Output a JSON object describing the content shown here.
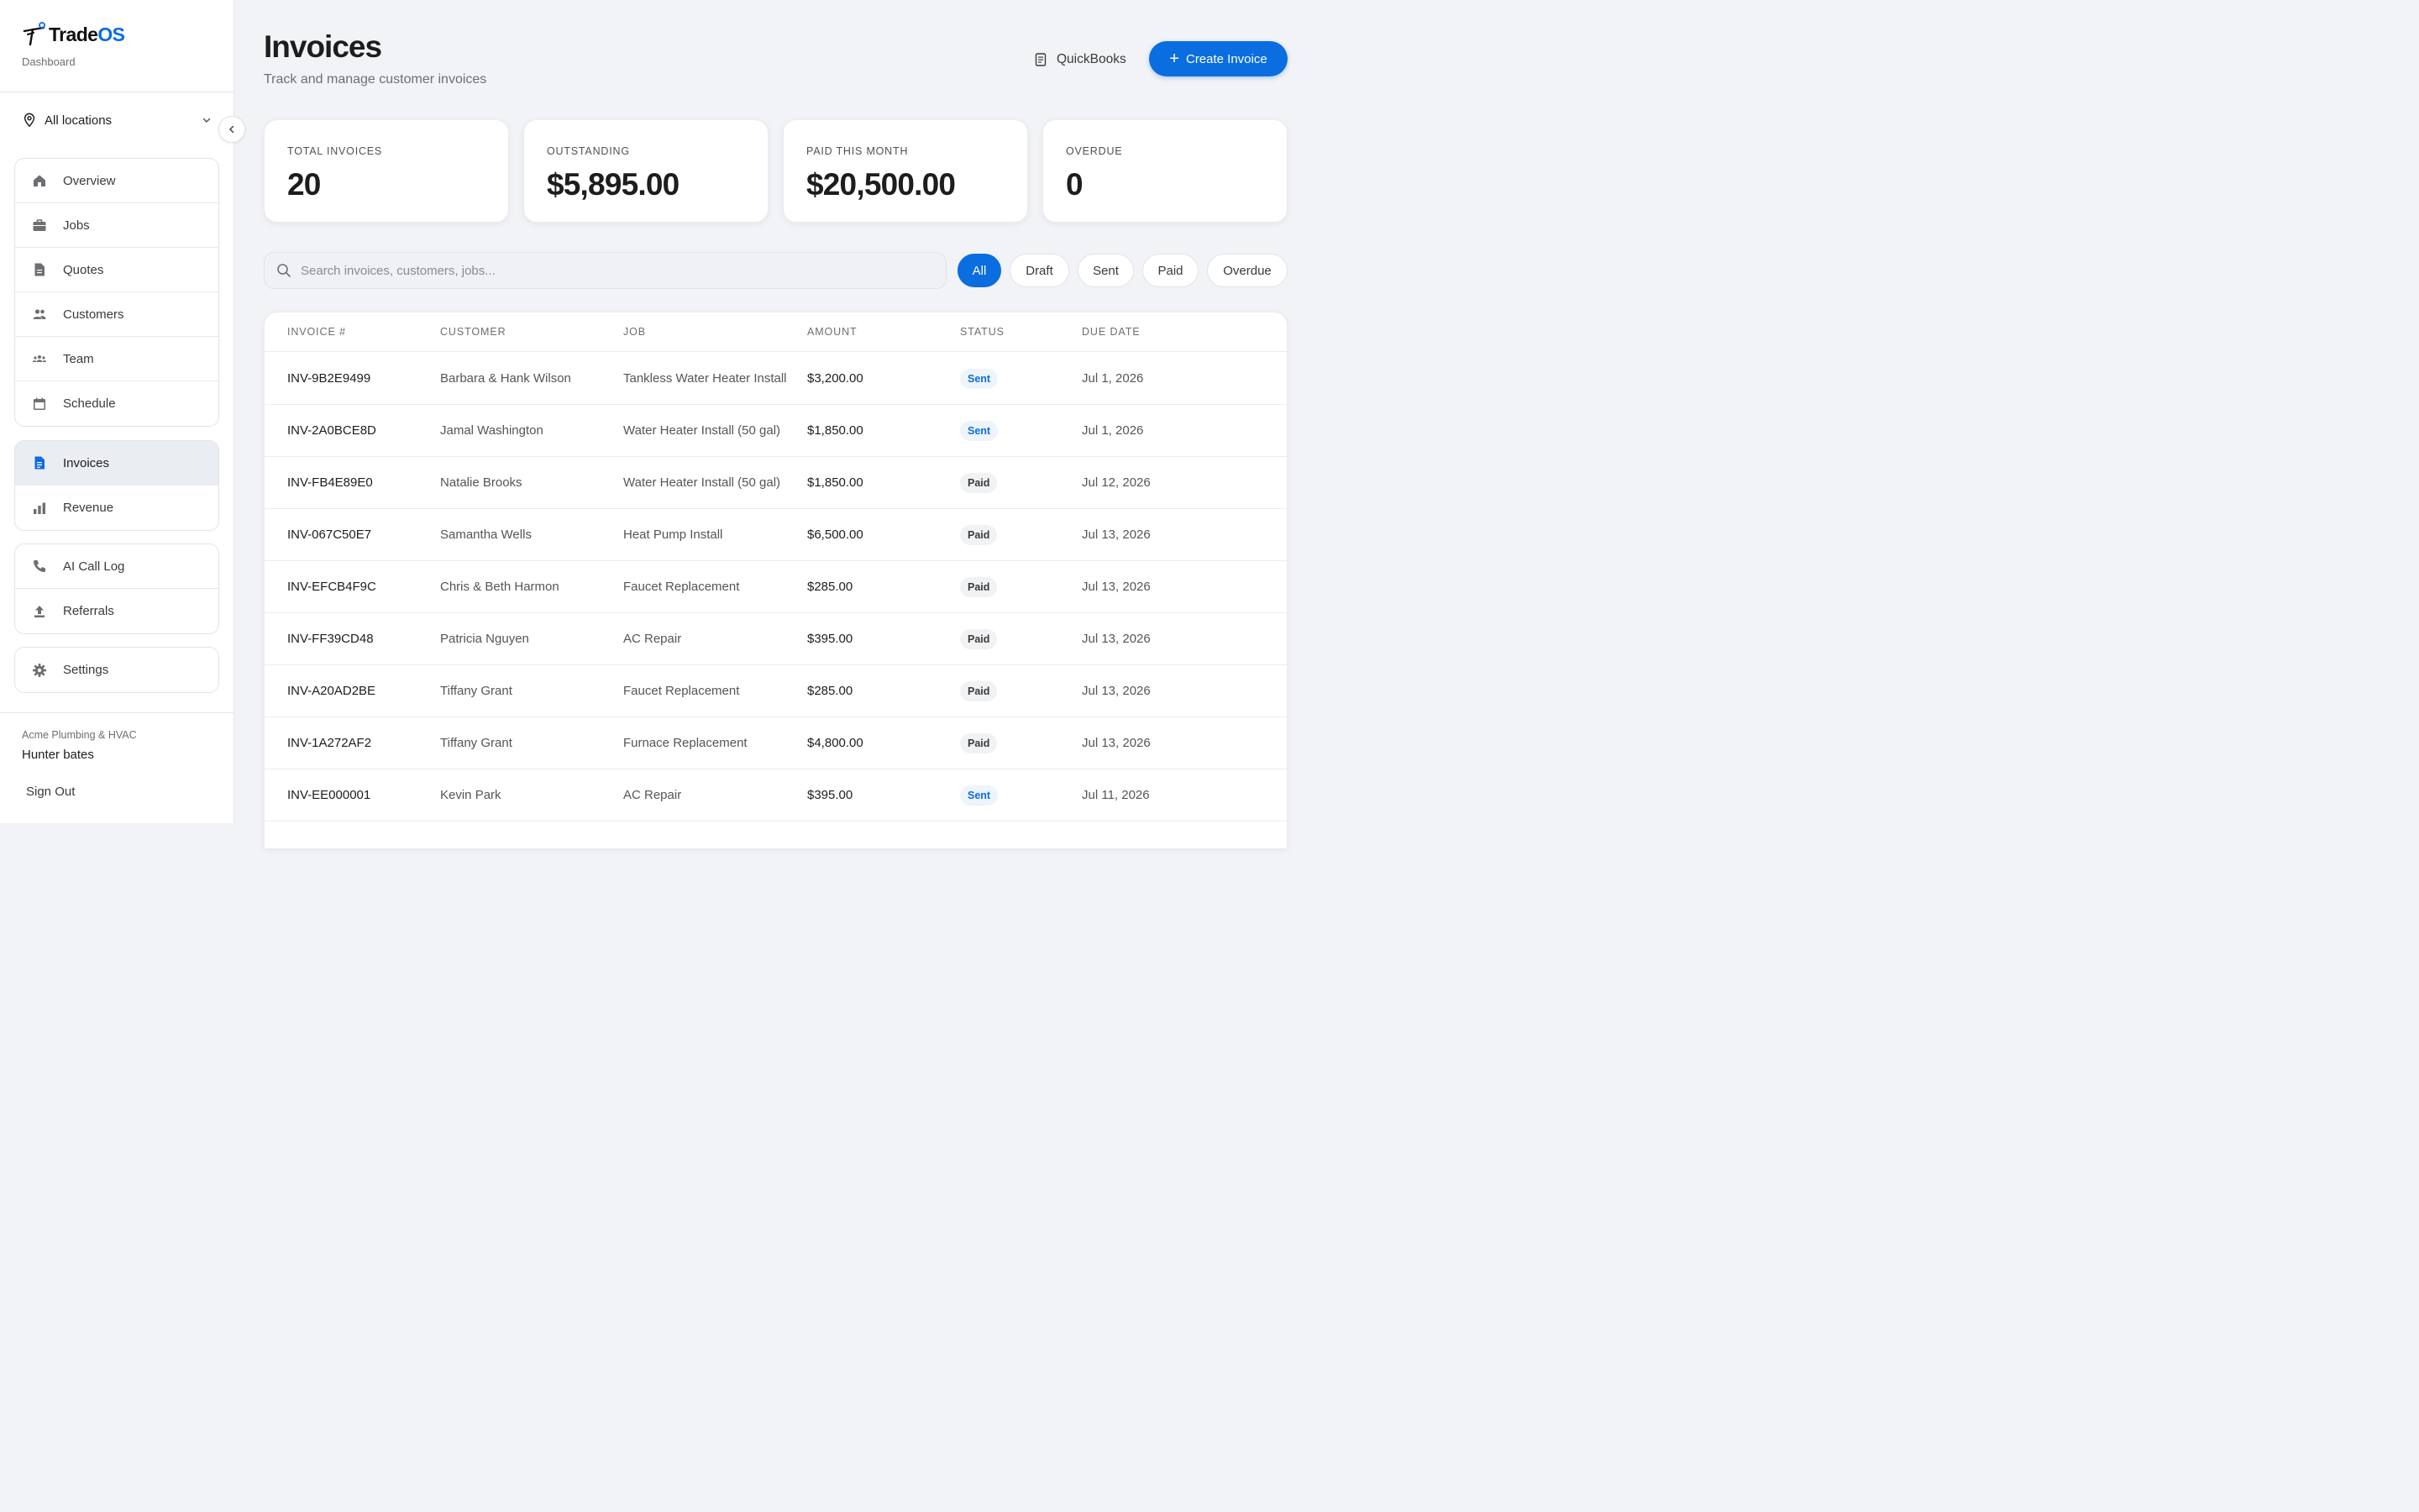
{
  "brand": {
    "name_main": "Trade",
    "name_accent": "OS",
    "subtitle": "Dashboard",
    "accent_color": "#0a6de0"
  },
  "location": {
    "label": "All locations"
  },
  "nav": {
    "main": [
      {
        "id": "overview",
        "label": "Overview",
        "icon": "home-icon"
      },
      {
        "id": "jobs",
        "label": "Jobs",
        "icon": "briefcase-icon"
      },
      {
        "id": "quotes",
        "label": "Quotes",
        "icon": "document-icon"
      },
      {
        "id": "customers",
        "label": "Customers",
        "icon": "people-icon"
      },
      {
        "id": "team",
        "label": "Team",
        "icon": "team-icon"
      },
      {
        "id": "schedule",
        "label": "Schedule",
        "icon": "calendar-icon"
      }
    ],
    "finance": [
      {
        "id": "invoices",
        "label": "Invoices",
        "icon": "invoice-icon",
        "active": true
      },
      {
        "id": "revenue",
        "label": "Revenue",
        "icon": "bar-chart-icon"
      }
    ],
    "tools": [
      {
        "id": "ai-call-log",
        "label": "AI Call Log",
        "icon": "phone-icon"
      },
      {
        "id": "referrals",
        "label": "Referrals",
        "icon": "upload-icon"
      }
    ],
    "settings": [
      {
        "id": "settings",
        "label": "Settings",
        "icon": "gear-icon"
      }
    ]
  },
  "account": {
    "org": "Acme Plumbing & HVAC",
    "user": "Hunter bates",
    "sign_out": "Sign Out"
  },
  "header": {
    "title": "Invoices",
    "subtitle": "Track and manage customer invoices",
    "quickbooks_label": "QuickBooks",
    "create_label": "Create Invoice"
  },
  "stats": [
    {
      "label": "TOTAL INVOICES",
      "value": "20"
    },
    {
      "label": "OUTSTANDING",
      "value": "$5,895.00"
    },
    {
      "label": "PAID THIS MONTH",
      "value": "$20,500.00"
    },
    {
      "label": "OVERDUE",
      "value": "0"
    }
  ],
  "search": {
    "placeholder": "Search invoices, customers, jobs..."
  },
  "filters": [
    {
      "label": "All",
      "active": true
    },
    {
      "label": "Draft",
      "active": false
    },
    {
      "label": "Sent",
      "active": false
    },
    {
      "label": "Paid",
      "active": false
    },
    {
      "label": "Overdue",
      "active": false
    }
  ],
  "table": {
    "columns": [
      "INVOICE #",
      "CUSTOMER",
      "JOB",
      "AMOUNT",
      "STATUS",
      "DUE DATE"
    ],
    "rows": [
      {
        "invoice": "INV-9B2E9499",
        "customer": "Barbara & Hank Wilson",
        "job": "Tankless Water Heater Install",
        "amount": "$3,200.00",
        "status": "Sent",
        "due": "Jul 1, 2026"
      },
      {
        "invoice": "INV-2A0BCE8D",
        "customer": "Jamal Washington",
        "job": "Water Heater Install (50 gal)",
        "amount": "$1,850.00",
        "status": "Sent",
        "due": "Jul 1, 2026"
      },
      {
        "invoice": "INV-FB4E89E0",
        "customer": "Natalie Brooks",
        "job": "Water Heater Install (50 gal)",
        "amount": "$1,850.00",
        "status": "Paid",
        "due": "Jul 12, 2026"
      },
      {
        "invoice": "INV-067C50E7",
        "customer": "Samantha Wells",
        "job": "Heat Pump Install",
        "amount": "$6,500.00",
        "status": "Paid",
        "due": "Jul 13, 2026"
      },
      {
        "invoice": "INV-EFCB4F9C",
        "customer": "Chris & Beth Harmon",
        "job": "Faucet Replacement",
        "amount": "$285.00",
        "status": "Paid",
        "due": "Jul 13, 2026"
      },
      {
        "invoice": "INV-FF39CD48",
        "customer": "Patricia Nguyen",
        "job": "AC Repair",
        "amount": "$395.00",
        "status": "Paid",
        "due": "Jul 13, 2026"
      },
      {
        "invoice": "INV-A20AD2BE",
        "customer": "Tiffany Grant",
        "job": "Faucet Replacement",
        "amount": "$285.00",
        "status": "Paid",
        "due": "Jul 13, 2026"
      },
      {
        "invoice": "INV-1A272AF2",
        "customer": "Tiffany Grant",
        "job": "Furnace Replacement",
        "amount": "$4,800.00",
        "status": "Paid",
        "due": "Jul 13, 2026"
      },
      {
        "invoice": "INV-EE000001",
        "customer": "Kevin Park",
        "job": "AC Repair",
        "amount": "$395.00",
        "status": "Sent",
        "due": "Jul 11, 2026"
      }
    ]
  }
}
